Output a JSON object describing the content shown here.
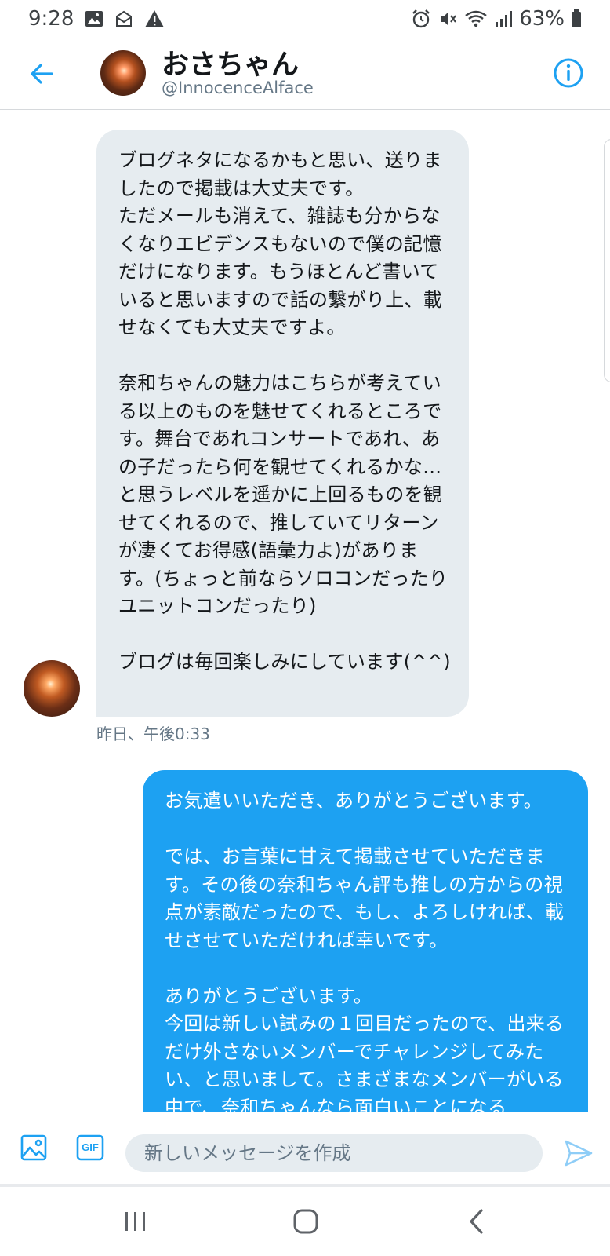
{
  "status_bar": {
    "time": "9:28",
    "left_icons": [
      "image-icon",
      "mail-icon",
      "warning-icon"
    ],
    "right_icons": [
      "alarm-icon",
      "mute-icon",
      "wifi-icon",
      "signal-icon",
      "battery-icon"
    ],
    "battery": "63%"
  },
  "header": {
    "name": "おさちゃん",
    "handle": "@InnocenceAlface",
    "icons": [
      "back-arrow-icon",
      "avatar",
      "info-icon"
    ]
  },
  "messages": [
    {
      "direction": "received",
      "text": "ブログネタになるかもと思い、送りましたので掲載は大丈夫です。\nただメールも消えて、雑誌も分からなくなりエビデンスもないので僕の記憶だけになります。もうほとんど書いていると思いますので話の繋がり上、載せなくても大丈夫ですよ。\n\n奈和ちゃんの魅力はこちらが考えている以上のものを魅せてくれるところです。舞台であれコンサートであれ、あの子だったら何を観せてくれるかな…と思うレベルを遥かに上回るものを観せてくれるので、推していてリターンが凄くてお得感(語彙力よ)があります。(ちょっと前ならソロコンだったりユニットコンだったり)\n\nブログは毎回楽しみにしています(^^)",
      "timestamp": "昨日、午後0:33"
    },
    {
      "direction": "sent",
      "text": "お気遣いいただき、ありがとうございます。\n\nでは、お言葉に甘えて掲載させていただきます。その後の奈和ちゃん評も推しの方からの視点が素敵だったので、もし、よろしければ、載せさせていただければ幸いです。\n\nありがとうございます。\n今回は新しい試みの１回目だったので、出来るだけ外さないメンバーでチャレンジしてみたい、と思いまして。さまざまなメンバーがいる中で、奈和ちゃんなら面白いことになる"
    }
  ],
  "composer": {
    "placeholder": "新しいメッセージを作成",
    "value": "",
    "gif_label": "GIF",
    "icons": [
      "image-icon",
      "gif-icon",
      "send-icon"
    ]
  },
  "nav_bar": {
    "icons": [
      "recents-icon",
      "home-icon",
      "back-icon"
    ]
  },
  "colors": {
    "accent": "#1da1f2",
    "received_bubble": "#e6ecf0",
    "secondary_text": "#657786"
  }
}
